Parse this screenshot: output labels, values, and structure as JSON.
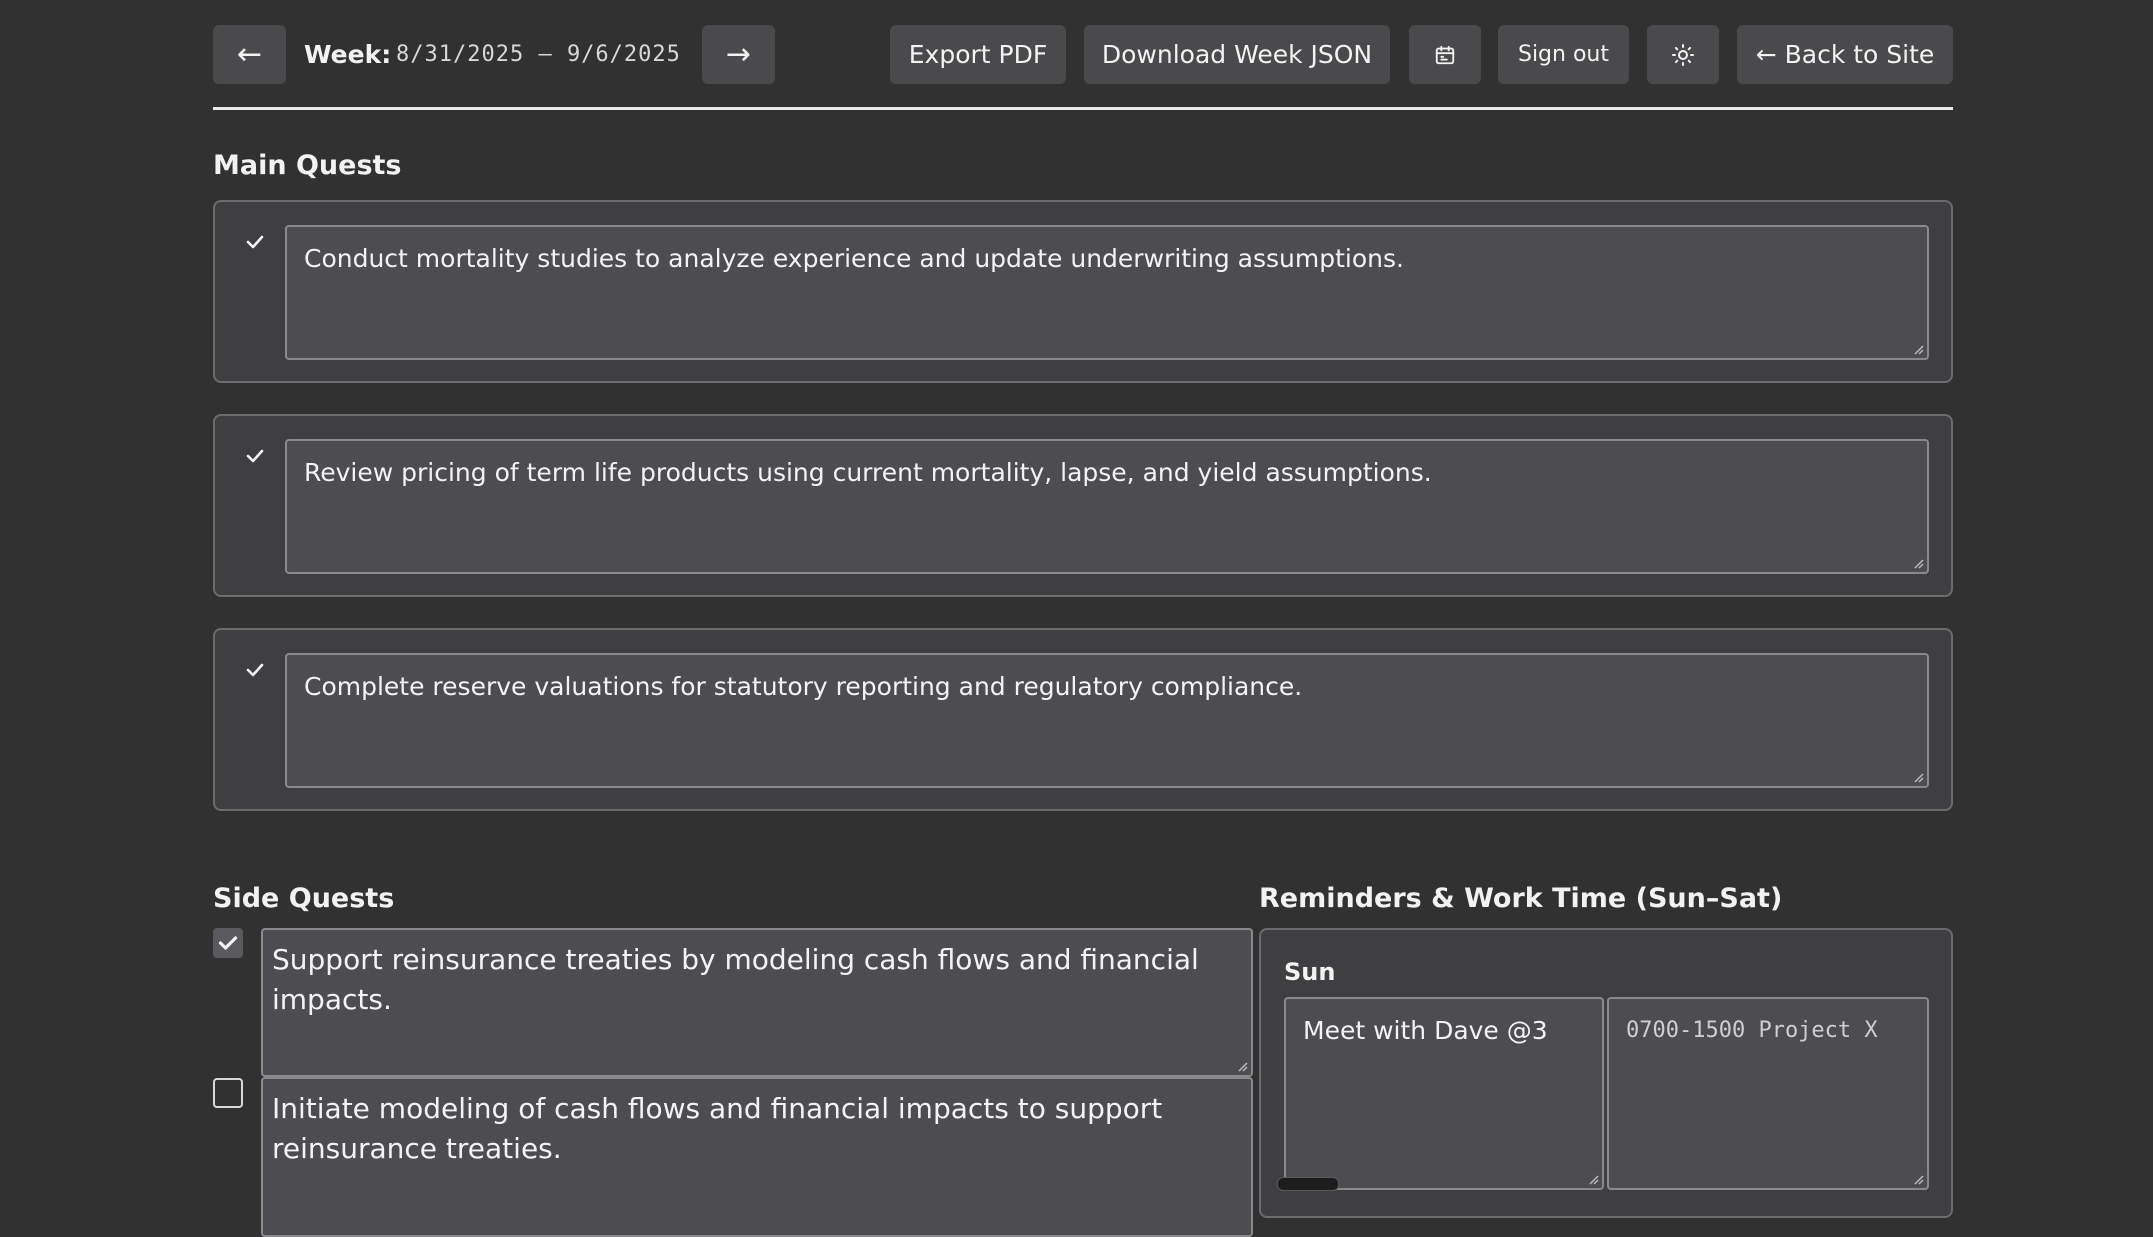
{
  "toolbar": {
    "prev_label": "←",
    "week_label": "Week:",
    "week_range": "8/31/2025 – 9/6/2025",
    "next_label": "→",
    "export_pdf_label": "Export PDF",
    "download_json_label": "Download Week JSON",
    "sign_out_label": "Sign out",
    "back_label": "← Back to Site"
  },
  "main_quests": {
    "title": "Main Quests",
    "items": [
      {
        "text": "Conduct mortality studies to analyze experience and update underwriting assumptions.",
        "done": true
      },
      {
        "text": "Review pricing of term life products using current mortality, lapse, and yield assumptions.",
        "done": true
      },
      {
        "text": "Complete reserve valuations for statutory reporting and regulatory compliance.",
        "done": true
      }
    ]
  },
  "side_quests": {
    "title": "Side Quests",
    "items": [
      {
        "text": "Support reinsurance treaties by modeling cash flows and financial impacts.",
        "done": true
      },
      {
        "text": "Initiate modeling of cash flows and financial impacts to support reinsurance treaties.",
        "done": false
      }
    ]
  },
  "reminders": {
    "title": "Reminders & Work Time (Sun–Sat)",
    "days": [
      {
        "day": "Sun",
        "reminder": "Meet with Dave @3",
        "work_time_placeholder": "0700-1500 Project X"
      }
    ]
  },
  "colors": {
    "background": "#313131",
    "card": "#3f3e41",
    "input": "#4d4c50",
    "button": "#4a494c"
  }
}
